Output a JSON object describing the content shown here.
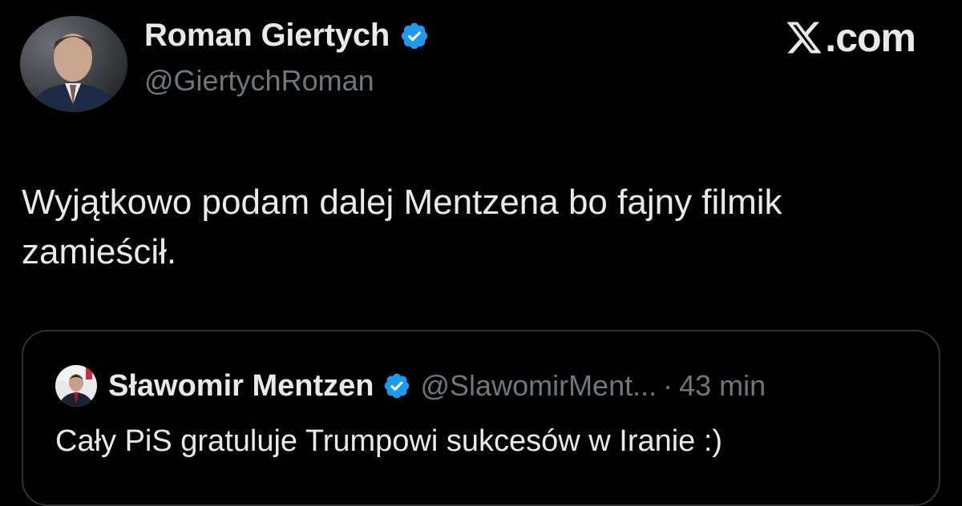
{
  "author": {
    "name": "Roman Giertych",
    "handle": "@GiertychRoman",
    "verified": true
  },
  "brand": {
    "text": ".com",
    "icon": "x-logo-icon"
  },
  "tweet": {
    "text": "Wyjątkowo podam dalej Mentzena bo fajny filmik zamieścił."
  },
  "quoted": {
    "name": "Sławomir Mentzen",
    "handle": "@SlawomirMent...",
    "separator": "·",
    "time": "43 min",
    "text": "Cały PiS gratuluje Trumpowi sukcesów w Iranie :)",
    "verified": true
  },
  "colors": {
    "background": "#000000",
    "text_primary": "#e7e9ea",
    "text_secondary": "#71767b",
    "verified_blue": "#1d9bf0",
    "border": "#2f3336"
  }
}
